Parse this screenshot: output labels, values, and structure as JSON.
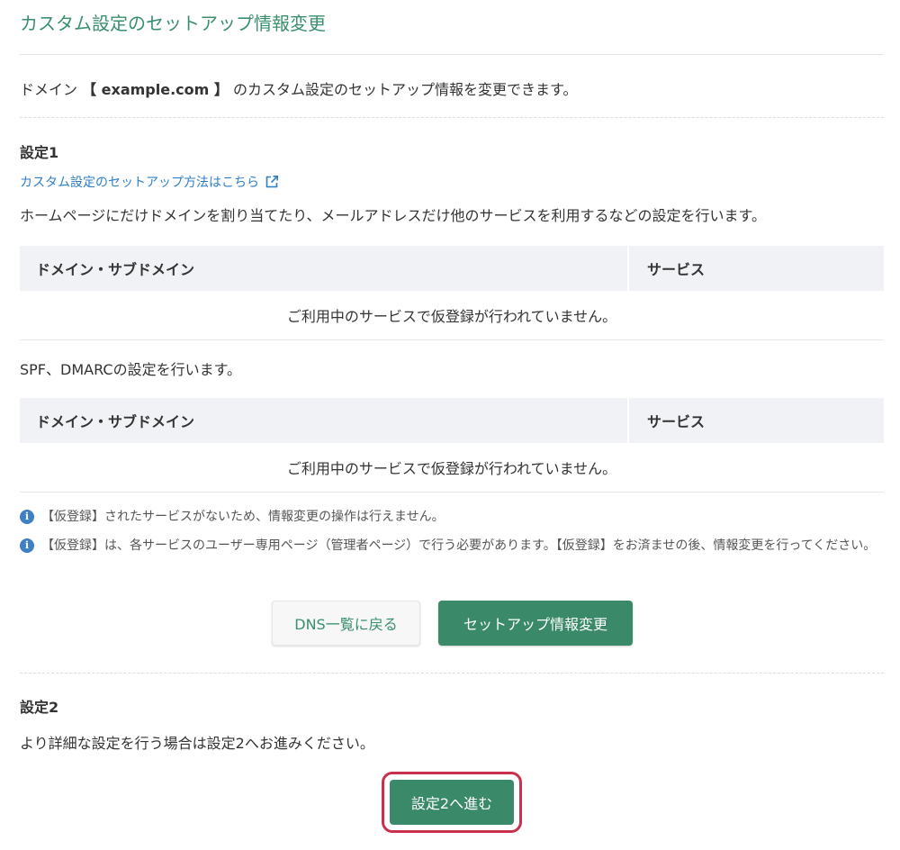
{
  "page": {
    "title": "カスタム設定のセットアップ情報変更",
    "intro": {
      "prefix": "ドメイン ",
      "domain": "【 example.com 】",
      "suffix": " のカスタム設定のセットアップ情報を変更できます。"
    }
  },
  "section1": {
    "heading": "設定1",
    "link_text": "カスタム設定のセットアップ方法はこちら",
    "description": "ホームページにだけドメインを割り当てたり、メールアドレスだけ他のサービスを利用するなどの設定を行います。",
    "table1": {
      "headers": [
        "ドメイン・サブドメイン",
        "サービス"
      ],
      "empty_message": "ご利用中のサービスで仮登録が行われていません。"
    },
    "spf_description": "SPF、DMARCの設定を行います。",
    "table2": {
      "headers": [
        "ドメイン・サブドメイン",
        "サービス"
      ],
      "empty_message": "ご利用中のサービスで仮登録が行われていません。"
    },
    "notes": [
      "【仮登録】されたサービスがないため、情報変更の操作は行えません。",
      "【仮登録】は、各サービスのユーザー専用ページ（管理者ページ）で行う必要があります。【仮登録】をお済ませの後、情報変更を行ってください。"
    ],
    "buttons": {
      "back_label": "DNS一覧に戻る",
      "primary_label": "セットアップ情報変更"
    }
  },
  "section2": {
    "heading": "設定2",
    "description": "より詳細な設定を行う場合は設定2へお進みください。",
    "button_label": "設定2へ進む"
  },
  "icons": {
    "link": "external-link-icon",
    "note": "info-icon"
  },
  "colors": {
    "accent": "#3a8a6a",
    "title": "#3a8f6e",
    "link": "#2f7fc8",
    "info": "#3f7fc4",
    "highlight": "#c8304c",
    "table_header_bg": "#f0f2f5"
  }
}
